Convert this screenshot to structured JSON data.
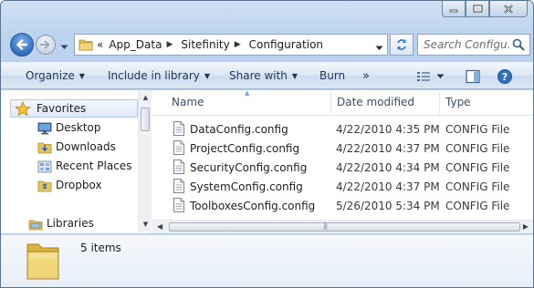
{
  "address": {
    "overflow": "«",
    "segments": [
      "App_Data",
      "Sitefinity",
      "Configuration"
    ]
  },
  "search": {
    "placeholder": "Search Configu..."
  },
  "toolbar": {
    "organize": "Organize",
    "include_in_library": "Include in library",
    "share_with": "Share with",
    "burn": "Burn",
    "more": "»"
  },
  "nav": {
    "favorites": "Favorites",
    "items": [
      "Desktop",
      "Downloads",
      "Recent Places",
      "Dropbox"
    ],
    "libraries": "Libraries"
  },
  "columns": {
    "name": "Name",
    "date": "Date modified",
    "type": "Type"
  },
  "files": [
    {
      "name": "DataConfig.config",
      "date": "4/22/2010 4:35 PM",
      "type": "CONFIG File"
    },
    {
      "name": "ProjectConfig.config",
      "date": "4/22/2010 4:37 PM",
      "type": "CONFIG File"
    },
    {
      "name": "SecurityConfig.config",
      "date": "4/22/2010 4:34 PM",
      "type": "CONFIG File"
    },
    {
      "name": "SystemConfig.config",
      "date": "4/22/2010 4:37 PM",
      "type": "CONFIG File"
    },
    {
      "name": "ToolboxesConfig.config",
      "date": "5/26/2010 5:34 PM",
      "type": "CONFIG File"
    }
  ],
  "details": {
    "count": "5 items"
  },
  "colors": {
    "accent": "#2f6fbf",
    "folder": "#e8c55a",
    "header_text": "#1e3354"
  }
}
